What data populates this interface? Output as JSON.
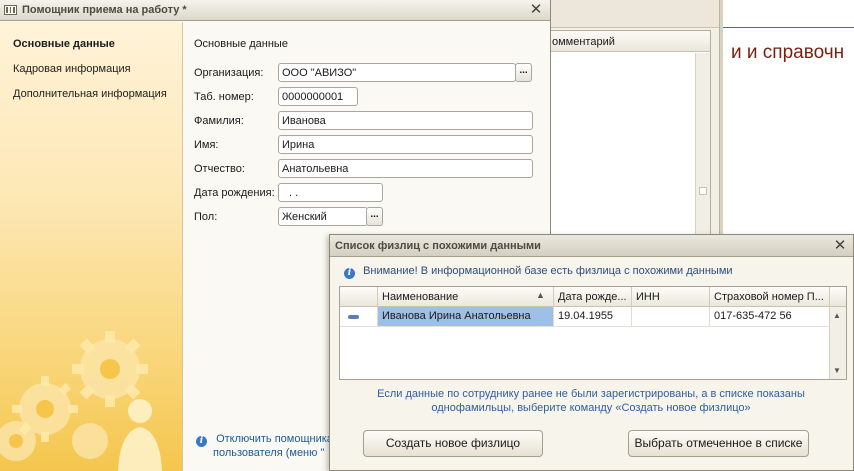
{
  "background": {
    "grid_column_header": "омментарий",
    "heading": "и и справочн"
  },
  "main_window": {
    "title": "Помощник приема на работу *",
    "nav": [
      {
        "label": "Основные данные",
        "active": true
      },
      {
        "label": "Кадровая информация",
        "active": false
      },
      {
        "label": "Дополнительная информация",
        "active": false
      }
    ],
    "section_title": "Основные данные",
    "fields": {
      "organization": {
        "label": "Организация:",
        "value": "ООО \"АВИЗО\""
      },
      "tab_number": {
        "label": "Таб. номер:",
        "value": "0000000001"
      },
      "last_name": {
        "label": "Фамилия:",
        "value": "Иванова"
      },
      "first_name": {
        "label": "Имя:",
        "value": "Ирина"
      },
      "patronymic": {
        "label": "Отчество:",
        "value": "Анатольевна"
      },
      "birth_date": {
        "label": "Дата рождения:",
        "value": ". ."
      },
      "gender": {
        "label": "Пол:",
        "value": "Женский"
      }
    },
    "ellipsis": "...",
    "bottom_info_line1": "Отключить помощника",
    "bottom_info_line2": "пользователя (меню \""
  },
  "dialog": {
    "title": "Список физлиц с похожими данными",
    "warning": "Внимание! В информационной базе есть физлица с похожими данными",
    "columns": [
      "Наименование",
      "Дата рожде...",
      "ИНН",
      "Страховой номер П..."
    ],
    "rows": [
      {
        "name": "Иванова Ирина Анатольевна",
        "birth_date": "19.04.1955",
        "inn": "",
        "snils": "017-635-472 56"
      }
    ],
    "hint": "Если данные по сотруднику ранее не были зарегистрированы, а в списке показаны однофамильцы, выберите команду «Создать новое физлицо»",
    "buttons": {
      "create": "Создать новое физлицо",
      "select": "Выбрать отмеченное в списке"
    }
  },
  "icons": [
    "app-window-icon",
    "close-icon",
    "info-icon",
    "gears-illustration",
    "sort-icon",
    "row-marker-icon",
    "scroll-up-icon",
    "scroll-down-icon"
  ],
  "colors": {
    "accent_blue": "#2e5ea0",
    "selection": "#9ec0e6",
    "sidebar_gold": "#f4c64d",
    "heading_red": "#7a1f10"
  }
}
